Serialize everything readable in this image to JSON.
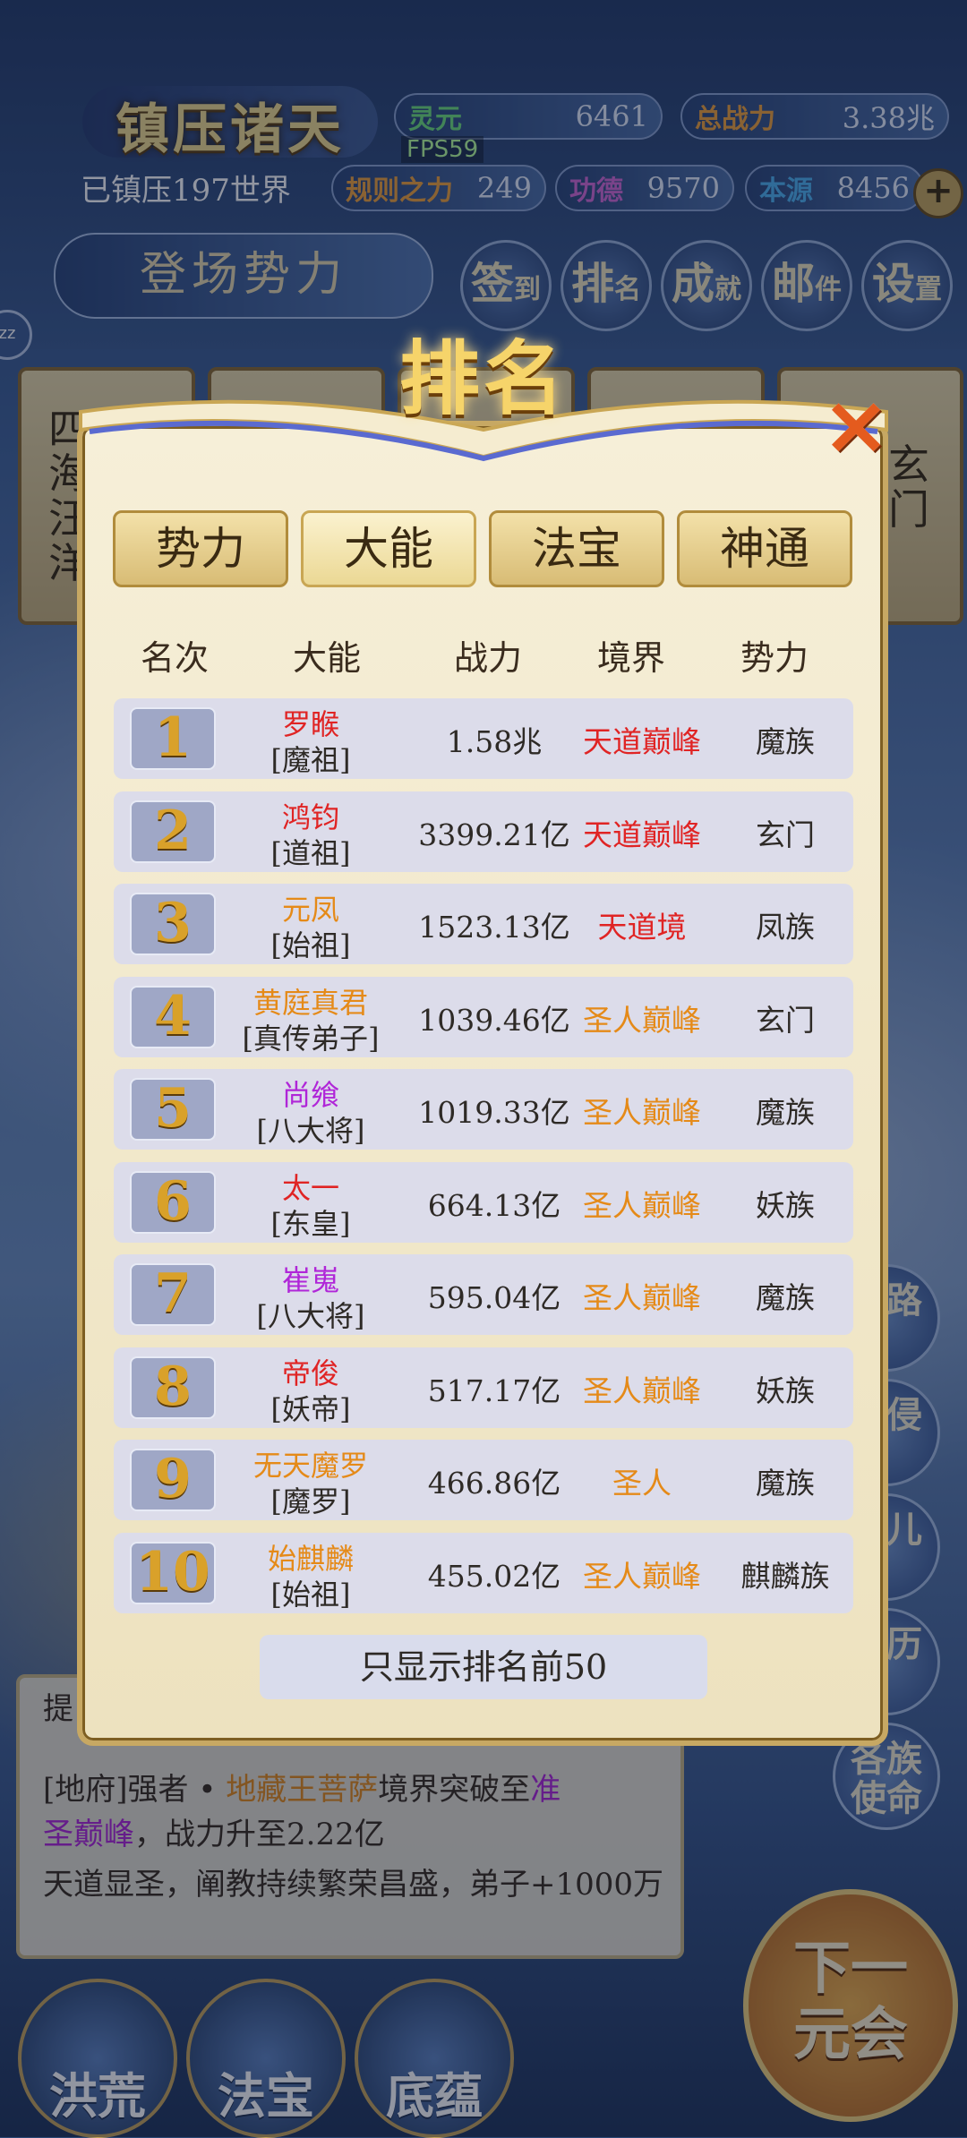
{
  "colors": {
    "red": "#e02424",
    "orange": "#e58a18",
    "purple": "#b026d8",
    "black": "#2e2a26"
  },
  "hud": {
    "title": "镇压诸天",
    "conquered": "已镇压197世界",
    "fps": "FPS59",
    "stats": [
      {
        "label": "灵元",
        "value": "6461",
        "color": "#6fe07a"
      },
      {
        "label": "总战力",
        "value": "3.38兆",
        "color": "#f0a23a"
      },
      {
        "label": "规则之力",
        "value": "249",
        "color": "#f0a23a"
      },
      {
        "label": "功德",
        "value": "9570",
        "color": "#d36ad6"
      },
      {
        "label": "本源",
        "value": "8456",
        "color": "#4fb3f0"
      }
    ],
    "plus": "+",
    "faction_button": "登场势力",
    "menu": [
      {
        "main": "签",
        "sub": "到"
      },
      {
        "main": "排",
        "sub": "名"
      },
      {
        "main": "成",
        "sub": "就"
      },
      {
        "main": "邮",
        "sub": "件"
      },
      {
        "main": "设",
        "sub": "置"
      }
    ],
    "side_badge": "zz"
  },
  "background_cards": [
    {
      "text": "四海汪洋"
    },
    {
      "text": "玄门"
    }
  ],
  "right_buttons": [
    {
      "label": "道路"
    },
    {
      "label": "域侵"
    },
    {
      "label": "道儿"
    },
    {
      "label": "身历"
    },
    {
      "label": "各族使命"
    }
  ],
  "log": {
    "prefix": "提",
    "line1_a": "[地府]强者 • ",
    "line1_b": "地藏王菩萨",
    "line1_c": "境界突破至",
    "line1_d": "准",
    "line2_a": "圣巅峰",
    "line2_b": "，战力升至2.22亿",
    "line3": "天道显圣，阐教持续繁荣昌盛，弟子+1000万"
  },
  "bottom_nav": [
    {
      "label": "洪荒",
      "icon": "lotus-icon"
    },
    {
      "label": "法宝",
      "icon": "cauldron-icon"
    },
    {
      "label": "底蕴",
      "icon": "flower-icon"
    }
  ],
  "next_button": {
    "line1": "下一",
    "line2": "元会"
  },
  "ranking": {
    "title": "排名",
    "close": "×",
    "tabs": [
      {
        "label": "势力",
        "active": false
      },
      {
        "label": "大能",
        "active": true
      },
      {
        "label": "法宝",
        "active": false
      },
      {
        "label": "神通",
        "active": false
      }
    ],
    "headers": {
      "rank": "名次",
      "name": "大能",
      "power": "战力",
      "realm": "境界",
      "faction": "势力"
    },
    "rows": [
      {
        "rank": "1",
        "name": "罗睺",
        "name_color": "#e02424",
        "title": "[魔祖]",
        "power": "1.58兆",
        "realm": "天道巅峰",
        "realm_color": "#e02424",
        "faction": "魔族"
      },
      {
        "rank": "2",
        "name": "鸿钧",
        "name_color": "#e02424",
        "title": "[道祖]",
        "power": "3399.21亿",
        "realm": "天道巅峰",
        "realm_color": "#e02424",
        "faction": "玄门"
      },
      {
        "rank": "3",
        "name": "元凤",
        "name_color": "#e58a18",
        "title": "[始祖]",
        "power": "1523.13亿",
        "realm": "天道境",
        "realm_color": "#e02424",
        "faction": "凤族"
      },
      {
        "rank": "4",
        "name": "黄庭真君",
        "name_color": "#e58a18",
        "title": "[真传弟子]",
        "power": "1039.46亿",
        "realm": "圣人巅峰",
        "realm_color": "#e58a18",
        "faction": "玄门"
      },
      {
        "rank": "5",
        "name": "尚飨",
        "name_color": "#b026d8",
        "title": "[八大将]",
        "power": "1019.33亿",
        "realm": "圣人巅峰",
        "realm_color": "#e58a18",
        "faction": "魔族"
      },
      {
        "rank": "6",
        "name": "太一",
        "name_color": "#e02424",
        "title": "[东皇]",
        "power": "664.13亿",
        "realm": "圣人巅峰",
        "realm_color": "#e58a18",
        "faction": "妖族"
      },
      {
        "rank": "7",
        "name": "崔嵬",
        "name_color": "#b026d8",
        "title": "[八大将]",
        "power": "595.04亿",
        "realm": "圣人巅峰",
        "realm_color": "#e58a18",
        "faction": "魔族"
      },
      {
        "rank": "8",
        "name": "帝俊",
        "name_color": "#e02424",
        "title": "[妖帝]",
        "power": "517.17亿",
        "realm": "圣人巅峰",
        "realm_color": "#e58a18",
        "faction": "妖族"
      },
      {
        "rank": "9",
        "name": "无天魔罗",
        "name_color": "#e58a18",
        "title": "[魔罗]",
        "power": "466.86亿",
        "realm": "圣人",
        "realm_color": "#e58a18",
        "faction": "魔族"
      },
      {
        "rank": "10",
        "name": "始麒麟",
        "name_color": "#e58a18",
        "title": "[始祖]",
        "power": "455.02亿",
        "realm": "圣人巅峰",
        "realm_color": "#e58a18",
        "faction": "麒麟族"
      }
    ],
    "footer": "只显示排名前50"
  }
}
